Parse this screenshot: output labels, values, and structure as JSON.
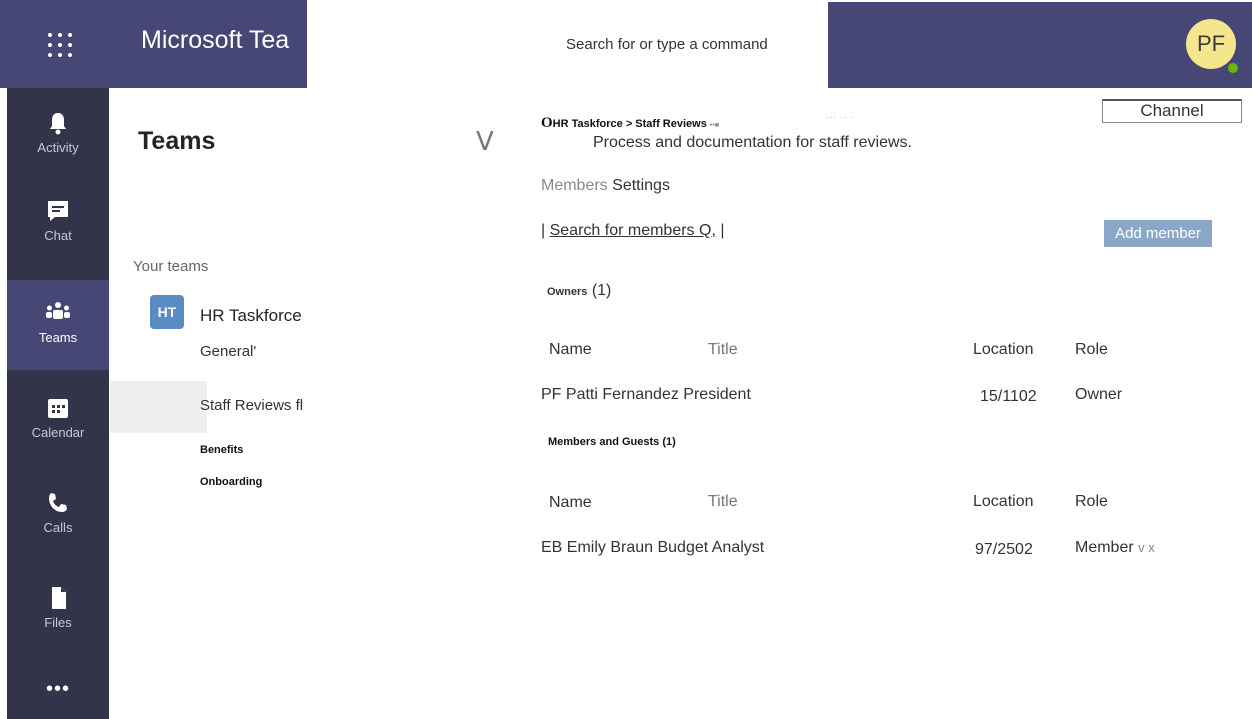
{
  "header": {
    "app_title": "Microsoft Tea",
    "search_placeholder": "Search for or type a command",
    "avatar_initials": "PF"
  },
  "rail": {
    "items": [
      {
        "label": "Activity",
        "icon": "bell-icon"
      },
      {
        "label": "Chat",
        "icon": "chat-icon"
      },
      {
        "label": "Teams",
        "icon": "teams-icon",
        "active": true
      },
      {
        "label": "Calendar",
        "icon": "calendar-icon"
      },
      {
        "label": "Calls",
        "icon": "phone-icon"
      },
      {
        "label": "Files",
        "icon": "file-icon"
      }
    ],
    "more": "•••"
  },
  "teams_pane": {
    "title": "Teams",
    "section_label": "Your teams",
    "team": {
      "badge": "HT",
      "name": "HR Taskforce"
    },
    "channels": [
      "General'",
      "Staff Reviews fl",
      "Benefits",
      "Onboarding"
    ],
    "collapse_glyph": "V"
  },
  "main": {
    "breadcrumb_o": "O",
    "breadcrumb": "HR Taskforce > Staff Reviews",
    "breadcrumb_tail": "••■",
    "description": "Process and documentation for staff reviews.",
    "channel_button": "Channel",
    "tabs": {
      "members": "Members",
      "settings": "Settings"
    },
    "member_search": {
      "prefix": "| ",
      "label": "Search for members Q,",
      "suffix": " |"
    },
    "add_member": "Add member",
    "owners": {
      "label": "Owners",
      "count": "(1)",
      "headers": {
        "name": "Name",
        "title": "Title",
        "location": "Location",
        "role": "Role"
      },
      "rows": [
        {
          "text": "PF Patti Fernandez President",
          "location": "15/1102",
          "role": "Owner"
        }
      ]
    },
    "members": {
      "label": "Members and Guests (1)",
      "headers": {
        "name": "Name",
        "title": "Title",
        "location": "Location",
        "role": "Role"
      },
      "rows": [
        {
          "text": "EB Emily Braun Budget Analyst",
          "location": "97/2502",
          "role": "Member",
          "controls": "v x"
        }
      ]
    }
  }
}
